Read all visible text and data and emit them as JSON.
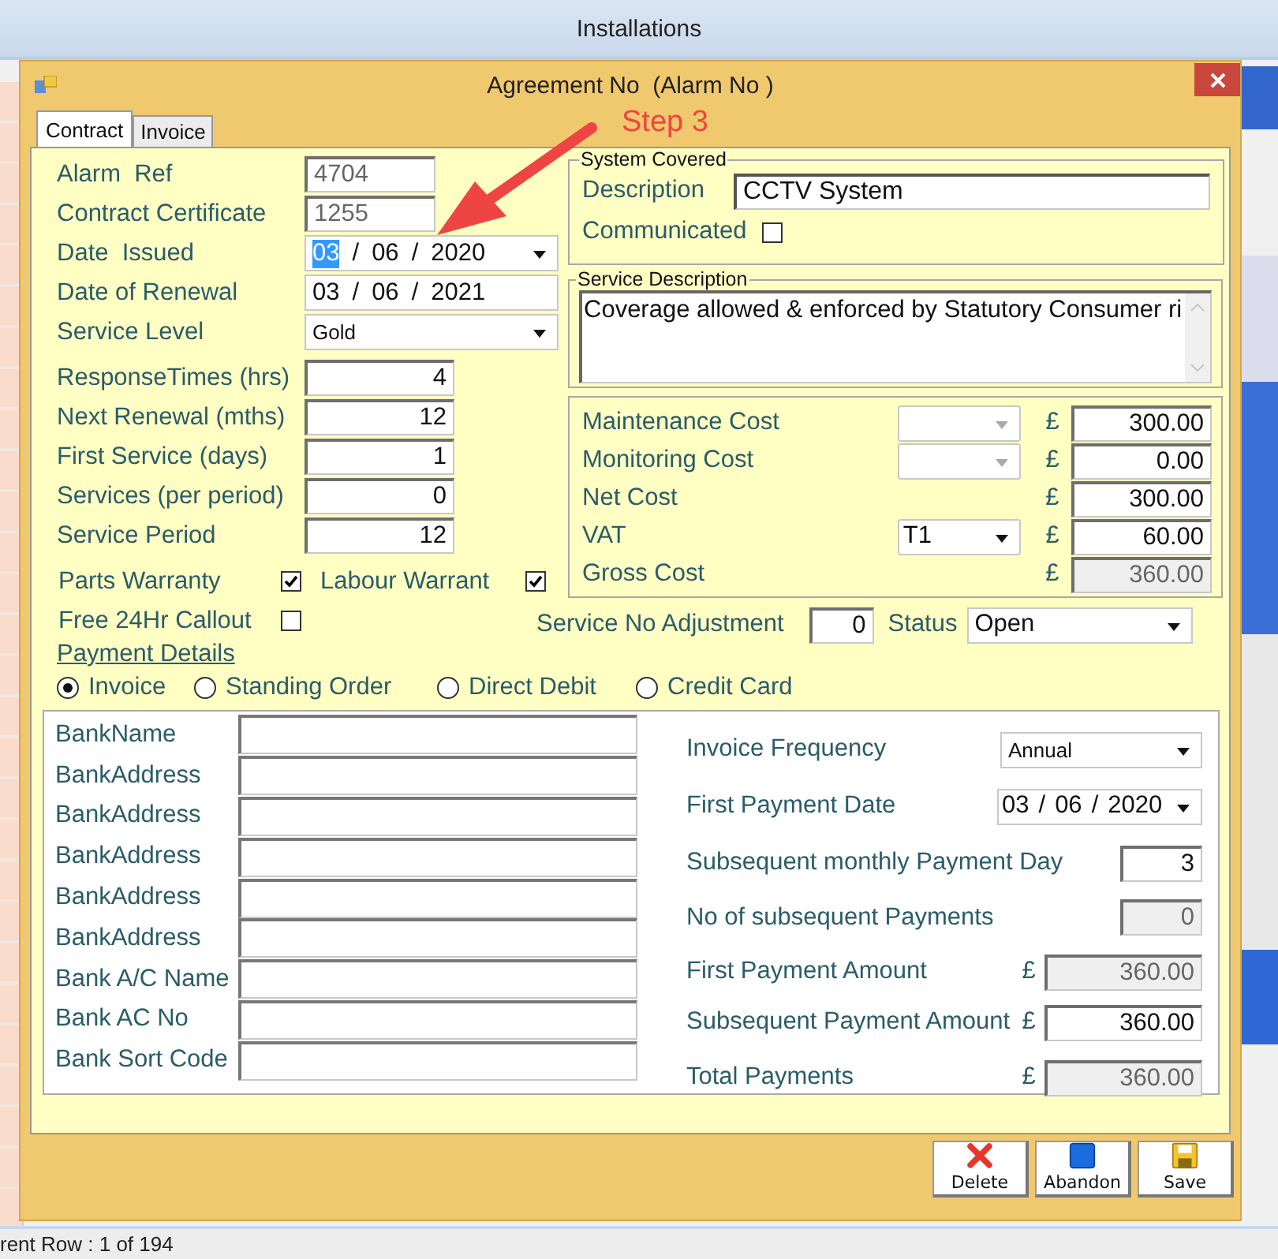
{
  "parent_window": {
    "title": "Installations",
    "status_bar": "rent Row : 1 of 194"
  },
  "dialog": {
    "title": "Agreement No  (Alarm No )"
  },
  "tabs": [
    {
      "label": "Contract",
      "selected": true
    },
    {
      "label": "Invoice",
      "selected": false
    }
  ],
  "annotation": {
    "text": "Step 3"
  },
  "details": [
    {
      "label": "Alarm  Ref",
      "kind": "text",
      "value": "4704"
    },
    {
      "label": "Contract Certificate",
      "kind": "text",
      "value": "1255"
    },
    {
      "label": "Date  Issued",
      "kind": "date",
      "dropdown": true,
      "separator": "/",
      "parts": [
        {
          "text": "03",
          "selected": true
        },
        {
          "text": "06",
          "selected": false
        },
        {
          "text": "2020",
          "selected": false
        }
      ]
    },
    {
      "label": "Date of Renewal",
      "kind": "date",
      "dropdown": false,
      "separator": "/",
      "parts": [
        {
          "text": "03",
          "selected": false
        },
        {
          "text": "06",
          "selected": false
        },
        {
          "text": "2021",
          "selected": false
        }
      ]
    },
    {
      "label": "Service Level",
      "kind": "select",
      "value": "Gold"
    }
  ],
  "periods": [
    {
      "label": "ResponseTimes (hrs)",
      "value": "4"
    },
    {
      "label": "Next Renewal (mths)",
      "value": "12"
    },
    {
      "label": "First Service (days)",
      "value": "1"
    },
    {
      "label": "Services (per period)",
      "value": "0"
    },
    {
      "label": "Service Period",
      "value": "12"
    }
  ],
  "warranties": [
    {
      "label": "Parts Warranty",
      "checked": true
    },
    {
      "label": "Labour Warrant",
      "checked": true
    },
    {
      "label": "Free 24Hr Callout",
      "checked": false
    }
  ],
  "payment_details": {
    "heading": "Payment Details"
  },
  "payment_methods": [
    {
      "label": "Invoice",
      "selected": true
    },
    {
      "label": "Standing Order",
      "selected": false
    },
    {
      "label": "Direct Debit",
      "selected": false
    },
    {
      "label": "Credit Card",
      "selected": false
    }
  ],
  "system_covered": {
    "title": "System Covered",
    "description_label": "Description",
    "description": "CCTV System",
    "communicated_label": "Communicated",
    "communicated": false
  },
  "service_description": {
    "title": "Service Description",
    "text": "Coverage allowed & enforced by Statutory Consumer ri"
  },
  "costs": [
    {
      "label": "Maintenance Cost",
      "kind": "empty-dropdown",
      "currency": "£",
      "value": "300.00",
      "readonly": false
    },
    {
      "label": "Monitoring Cost",
      "kind": "empty-dropdown",
      "currency": "£",
      "value": "0.00",
      "readonly": false
    },
    {
      "label": "Net Cost",
      "kind": "plain",
      "currency": "£",
      "value": "300.00",
      "readonly": false
    },
    {
      "label": "VAT",
      "kind": "dropdown",
      "selector_value": "T1",
      "currency": "£",
      "value": "60.00",
      "readonly": false
    },
    {
      "label": "Gross Cost",
      "kind": "plain",
      "currency": "£",
      "value": "360.00",
      "readonly": true
    }
  ],
  "adjustment": {
    "label": "Service No Adjustment",
    "value": "0"
  },
  "status": {
    "label": "Status",
    "value": "Open"
  },
  "bank_fields": [
    {
      "label": "BankName"
    },
    {
      "label": "BankAddress"
    },
    {
      "label": "BankAddress"
    },
    {
      "label": "BankAddress"
    },
    {
      "label": "BankAddress"
    },
    {
      "label": "BankAddress"
    },
    {
      "label": "Bank A/C Name"
    },
    {
      "label": "Bank AC No"
    },
    {
      "label": "Bank Sort Code"
    }
  ],
  "invoice_fields": [
    {
      "label": "Invoice Frequency",
      "kind": "select",
      "value": "Annual"
    },
    {
      "label": "First Payment Date",
      "kind": "date",
      "separator": "/",
      "parts": [
        "03",
        "06",
        "2020"
      ]
    },
    {
      "label": "Subsequent monthly Payment Day",
      "kind": "number",
      "value": "3",
      "readonly": false
    },
    {
      "label": "No of subsequent Payments",
      "kind": "number",
      "value": "0",
      "readonly": true
    },
    {
      "label": "First Payment Amount",
      "kind": "money",
      "currency": "£",
      "value": "360.00",
      "readonly": true
    },
    {
      "label": "Subsequent Payment Amount",
      "kind": "money",
      "currency": "£",
      "value": "360.00",
      "readonly": false
    },
    {
      "label": "Total Payments",
      "kind": "money",
      "currency": "£",
      "value": "360.00",
      "readonly": true
    }
  ],
  "buttons": [
    {
      "label": "Delete",
      "kind": "delete"
    },
    {
      "label": "Abandon",
      "kind": "abandon"
    },
    {
      "label": "Save",
      "kind": "save"
    }
  ]
}
